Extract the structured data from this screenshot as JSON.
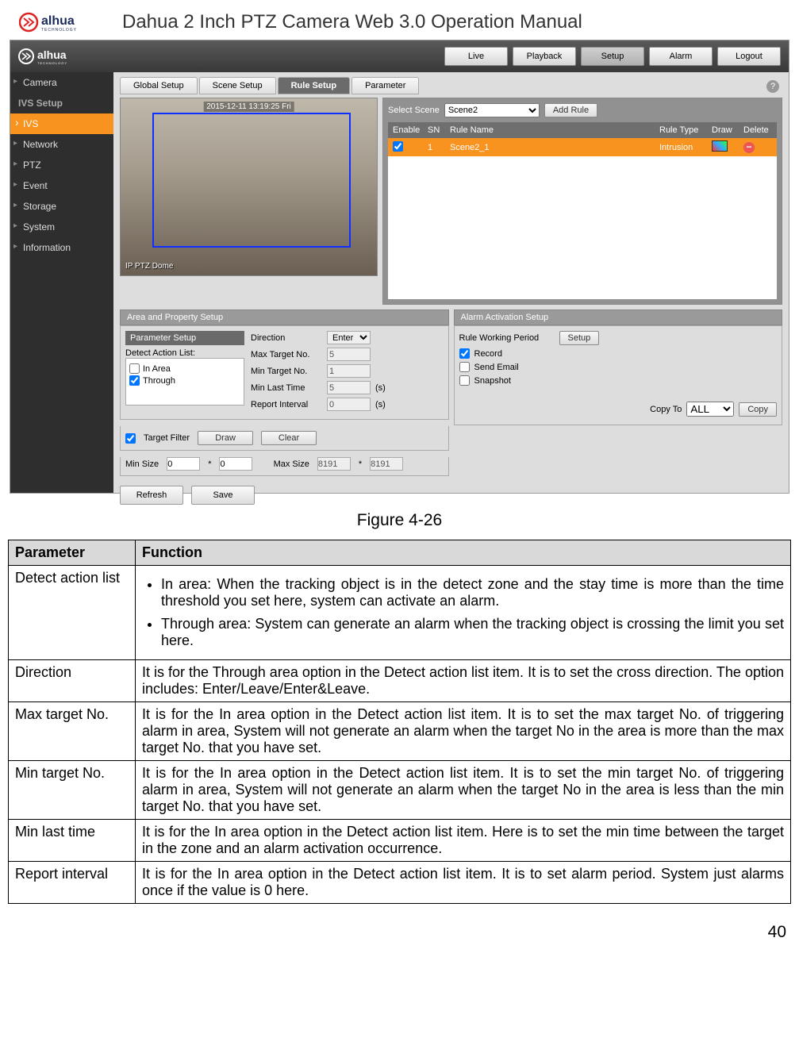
{
  "header": {
    "title": "Dahua 2 Inch PTZ Camera Web 3.0 Operation Manual",
    "logo_text": "alhua",
    "logo_sub": "TECHNOLOGY"
  },
  "screenshot": {
    "topnav": [
      "Live",
      "Playback",
      "Setup",
      "Alarm",
      "Logout"
    ],
    "topnav_active": 2,
    "sidebar": [
      "Camera",
      "IVS Setup",
      "IVS",
      "Network",
      "PTZ",
      "Event",
      "Storage",
      "System",
      "Information"
    ],
    "sidebar_active": 2,
    "tabs": [
      "Global Setup",
      "Scene Setup",
      "Rule Setup",
      "Parameter"
    ],
    "tabs_active": 2,
    "help_tooltip": "?",
    "video": {
      "timestamp": "2015-12-11 13:19:25 Fri",
      "label": "IP PTZ Dome"
    },
    "rule": {
      "select_scene_label": "Select Scene",
      "select_scene_value": "Scene2",
      "add_rule": "Add Rule",
      "head": [
        "Enable",
        "SN",
        "Rule Name",
        "Rule Type",
        "Draw",
        "Delete"
      ],
      "row": {
        "enable": true,
        "sn": "1",
        "rule_name": "Scene2_1",
        "rule_type": "Intrusion"
      }
    },
    "area_label": "Area and Property Setup",
    "param_setup": {
      "title": "Parameter Setup",
      "detect_list_title": "Detect Action List:",
      "in_area_label": "In Area",
      "in_area_checked": false,
      "through_label": "Through",
      "through_checked": true,
      "direction_label": "Direction",
      "direction_value": "Enter",
      "max_target_label": "Max Target No.",
      "max_target_value": "5",
      "min_target_label": "Min Target No.",
      "min_target_value": "1",
      "min_last_label": "Min Last Time",
      "min_last_value": "5",
      "report_label": "Report Interval",
      "report_value": "0",
      "unit_s": "(s)",
      "target_filter_label": "Target Filter",
      "target_filter_checked": true,
      "draw_btn": "Draw",
      "clear_btn": "Clear",
      "min_size_label": "Min Size",
      "min_w": "0",
      "min_h": "0",
      "max_size_label": "Max Size",
      "max_w": "8191",
      "max_h": "8191"
    },
    "alarm": {
      "label": "Alarm Activation Setup",
      "rwp_label": "Rule Working Period",
      "setup_btn": "Setup",
      "record_label": "Record",
      "record_checked": true,
      "email_label": "Send Email",
      "email_checked": false,
      "snapshot_label": "Snapshot",
      "snapshot_checked": false,
      "copyto_label": "Copy To",
      "copyto_value": "ALL",
      "copy_btn": "Copy"
    },
    "buttons": {
      "refresh": "Refresh",
      "save": "Save"
    }
  },
  "figure_caption": "Figure 4-26",
  "table": {
    "head": [
      "Parameter",
      "Function"
    ],
    "rows": [
      {
        "param": "Detect action list",
        "bullets": [
          "In area: When the tracking object is in the detect zone and the stay time is more than the time threshold you set here, system can activate an alarm.",
          "Through area: System can generate an alarm when the tracking object is crossing the limit you set here."
        ]
      },
      {
        "param": "Direction",
        "desc": "It is for the Through area option in the Detect action list item. It is to set the cross direction. The option includes: Enter/Leave/Enter&Leave."
      },
      {
        "param": "Max target No.",
        "desc": "It is for the In area option in the Detect action list item. It is to set the max target No. of triggering alarm in area, System will not generate an alarm when the target No in the area is more than the max target No. that you have set."
      },
      {
        "param": "Min target No.",
        "desc": "It is for the In area option in the Detect action list item. It is to set the min target No. of triggering alarm in area, System will not generate an alarm when the target No in the area is less than the min target No. that you have set."
      },
      {
        "param": "Min last time",
        "desc": "It is for the In area option in the Detect action list item. Here is to set the min time between the target in the zone and an alarm activation occurrence."
      },
      {
        "param": "Report interval",
        "desc": "It is for the In area option in the Detect action list item. It is to set alarm period. System just alarms once if the value is 0 here."
      }
    ]
  },
  "page_number": "40"
}
